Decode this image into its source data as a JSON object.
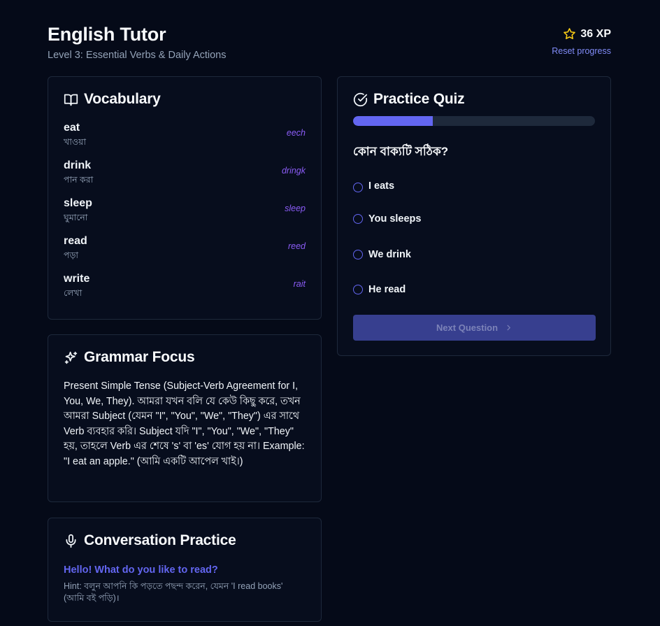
{
  "header": {
    "title": "English Tutor",
    "subtitle": "Level 3: Essential Verbs & Daily Actions",
    "xp": "36 XP",
    "reset_label": "Reset progress"
  },
  "vocabulary": {
    "title": "Vocabulary",
    "items": [
      {
        "word": "eat",
        "meaning": "খাওয়া",
        "pronunciation": "eech"
      },
      {
        "word": "drink",
        "meaning": "পান করা",
        "pronunciation": "dringk"
      },
      {
        "word": "sleep",
        "meaning": "ঘুমানো",
        "pronunciation": "sleep"
      },
      {
        "word": "read",
        "meaning": "পড়া",
        "pronunciation": "reed"
      },
      {
        "word": "write",
        "meaning": "লেখা",
        "pronunciation": "rait"
      }
    ]
  },
  "grammar": {
    "title": "Grammar Focus",
    "text": "Present Simple Tense (Subject-Verb Agreement for I, You, We, They). আমরা যখন বলি যে কেউ কিছু করে, তখন আমরা Subject (যেমন \"I\", \"You\", \"We\", \"They\") এর সাথে Verb ব্যবহার করি। Subject যদি \"I\", \"You\", \"We\", \"They\" হয়, তাহলে Verb এর শেষে 's' বা 'es' যোগ হয় না। Example: \"I eat an apple.\" (আমি একটি আপেল খাই।)"
  },
  "conversation": {
    "title": "Conversation Practice",
    "prompt": "Hello! What do you like to read?",
    "hint": "Hint: বলুন আপনি কি পড়তে পছন্দ করেন, যেমন 'I read books' (আমি বই পড়ি)।"
  },
  "quiz": {
    "title": "Practice Quiz",
    "progress": 0.33,
    "question": "কোন বাক্যটি সঠিক?",
    "options": [
      "I eats",
      "You sleeps",
      "We drink",
      "He read"
    ],
    "next_label": "Next Question"
  },
  "colors": {
    "accent": "#6366f1",
    "pronunciation": "#8b5cf6",
    "background": "#050a18",
    "card_border": "#1e293b",
    "star": "#facc15"
  }
}
